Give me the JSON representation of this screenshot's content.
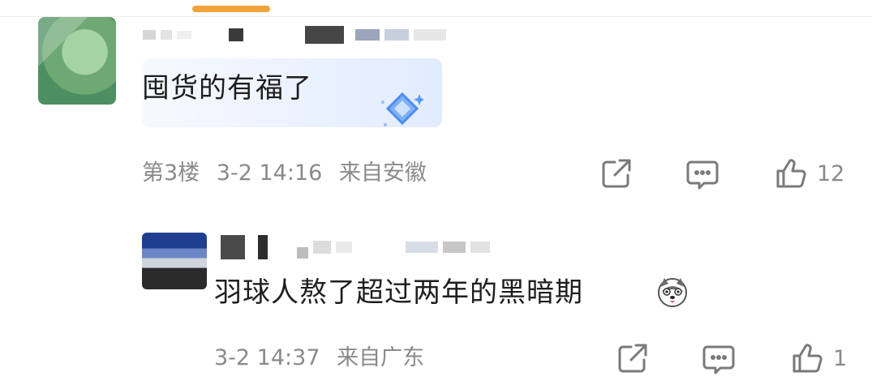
{
  "comments": [
    {
      "text": "囤货的有福了",
      "floor": "第3楼",
      "time": "3-2 14:16",
      "location": "来自安徽",
      "like_count": "12"
    },
    {
      "text": "羽球人熬了超过两年的黑暗期",
      "time": "3-2 14:37",
      "location": "来自广东",
      "like_count": "1"
    }
  ],
  "icons": {
    "share": "share-icon",
    "comment": "comment-icon",
    "like": "thumbs-up-icon",
    "badge": "diamond-icon",
    "emoji": "husky-emoji-icon"
  },
  "colors": {
    "accent": "#f3a33a",
    "meta_text": "#8a8a8a",
    "body_text": "#1e1e1e"
  }
}
